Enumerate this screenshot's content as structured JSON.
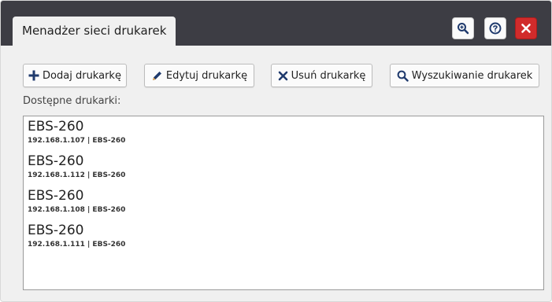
{
  "window": {
    "tab_title": "Menadżer sieci drukarek"
  },
  "titlebar_buttons": [
    {
      "icon": "zoom-in-icon",
      "color": "#fafafa"
    },
    {
      "icon": "help-icon",
      "color": "#fafafa"
    },
    {
      "icon": "close-icon",
      "color": "#d12b2b"
    }
  ],
  "toolbar": {
    "add_label": "Dodaj drukarkę",
    "edit_label": "Edytuj drukarkę",
    "remove_label": "Usuń drukarkę",
    "search_label": "Wyszukiwanie drukarek",
    "icon_color": "#1f3a6d"
  },
  "printers": {
    "label": "Dostępne drukarki:",
    "items": [
      {
        "name": "EBS-260",
        "detail": "192.168.1.107 | EBS-260"
      },
      {
        "name": "EBS-260",
        "detail": "192.168.1.112 | EBS-260"
      },
      {
        "name": "EBS-260",
        "detail": "192.168.1.108 | EBS-260"
      },
      {
        "name": "EBS-260",
        "detail": "192.168.1.111 | EBS-260"
      }
    ]
  }
}
